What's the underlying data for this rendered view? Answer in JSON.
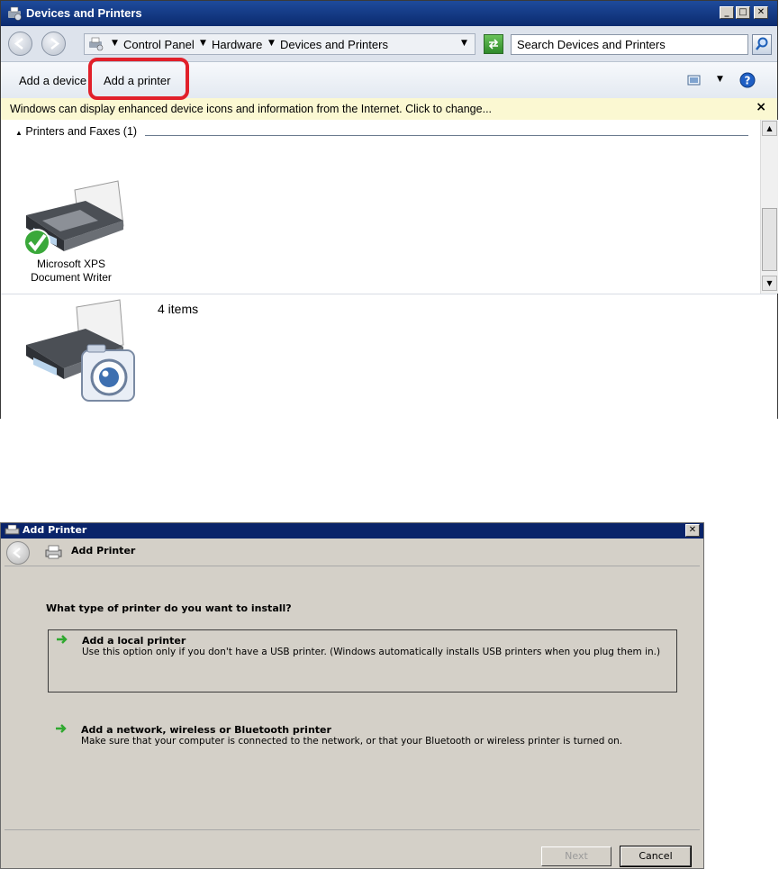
{
  "window1": {
    "title": "Devices and Printers",
    "breadcrumb": [
      "Control Panel",
      "Hardware",
      "Devices and Printers"
    ],
    "search_placeholder": "Search Devices and Printers",
    "commands": {
      "add_device": "Add a device",
      "add_printer": "Add a printer"
    },
    "info_bar": "Windows can display enhanced device icons and information from the Internet. Click to change...",
    "info_close": "×",
    "group_header": "Printers and Faxes (1)",
    "devices": [
      {
        "label_line1": "Microsoft XPS",
        "label_line2": "Document Writer"
      }
    ],
    "details_count": "4 items",
    "caption_buttons": {
      "minimize": "_",
      "maximize": "□",
      "close": "✕"
    }
  },
  "window2": {
    "title": "Add Printer",
    "header_title": "Add Printer",
    "question": "What type of printer do you want to install?",
    "options": [
      {
        "title": "Add a local printer",
        "description": "Use this option only if you don't have a USB printer. (Windows automatically installs USB printers when you plug them in.)"
      },
      {
        "title": "Add a network, wireless or Bluetooth printer",
        "description": "Make sure that your computer is connected to the network, or that your Bluetooth or wireless printer is turned on."
      }
    ],
    "buttons": {
      "next": "Next",
      "cancel": "Cancel"
    },
    "close": "✕"
  },
  "colors": {
    "highlight": "#e1202a",
    "titlebar": "#0a246a",
    "arrow": "#2fa82f"
  }
}
